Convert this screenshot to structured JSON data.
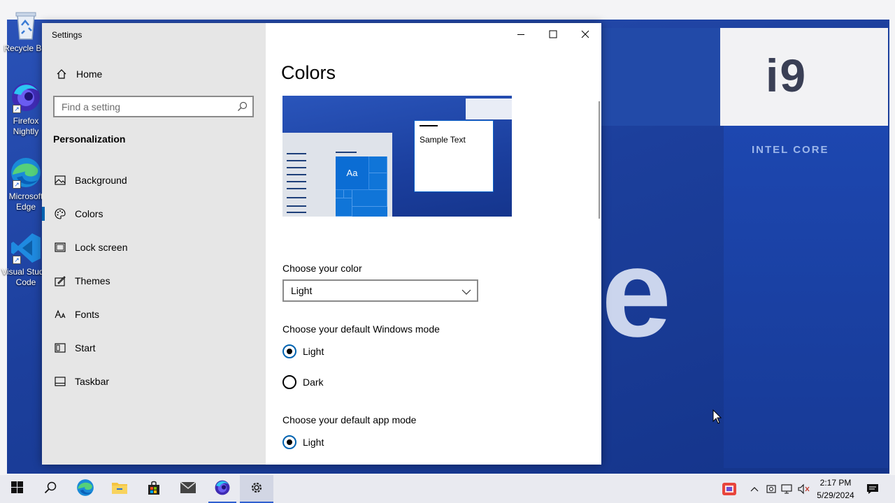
{
  "desktop": {
    "wallpaper_text": {
      "brand": "i9",
      "sub": "INTEL CORE",
      "letter": "e"
    },
    "icons": [
      {
        "name": "recycle-bin",
        "label": "Recycle Bin"
      },
      {
        "name": "firefox-nightly",
        "label": "Firefox Nightly"
      },
      {
        "name": "microsoft-edge",
        "label": "Microsoft Edge"
      },
      {
        "name": "visual-studio-code",
        "label": "Visual Studio Code"
      }
    ]
  },
  "window": {
    "title": "Settings",
    "controls": {
      "minimize": "—",
      "maximize": "☐",
      "close": "✕"
    },
    "sidebar": {
      "home_label": "Home",
      "search_placeholder": "Find a setting",
      "section_title": "Personalization",
      "items": [
        {
          "label": "Background",
          "icon": "picture-icon"
        },
        {
          "label": "Colors",
          "icon": "palette-icon",
          "active": true
        },
        {
          "label": "Lock screen",
          "icon": "lock-screen-icon"
        },
        {
          "label": "Themes",
          "icon": "brush-icon"
        },
        {
          "label": "Fonts",
          "icon": "font-icon"
        },
        {
          "label": "Start",
          "icon": "start-icon"
        },
        {
          "label": "Taskbar",
          "icon": "taskbar-icon"
        }
      ]
    },
    "content": {
      "page_title": "Colors",
      "preview": {
        "tile_text": "Aa",
        "sample_text": "Sample Text"
      },
      "choose_color_label": "Choose your color",
      "choose_color_value": "Light",
      "windows_mode_label": "Choose your default Windows mode",
      "windows_mode_options": [
        "Light",
        "Dark"
      ],
      "windows_mode_selected": "Light",
      "app_mode_label": "Choose your default app mode",
      "app_mode_options": [
        "Light"
      ],
      "app_mode_selected": "Light"
    }
  },
  "taskbar": {
    "pinned": [
      "start",
      "search",
      "edge",
      "file-explorer",
      "microsoft-store",
      "mail",
      "firefox-nightly",
      "settings"
    ],
    "clock": {
      "time": "2:17 PM",
      "date": "5/29/2024"
    },
    "accent_color": "#0063b1"
  }
}
